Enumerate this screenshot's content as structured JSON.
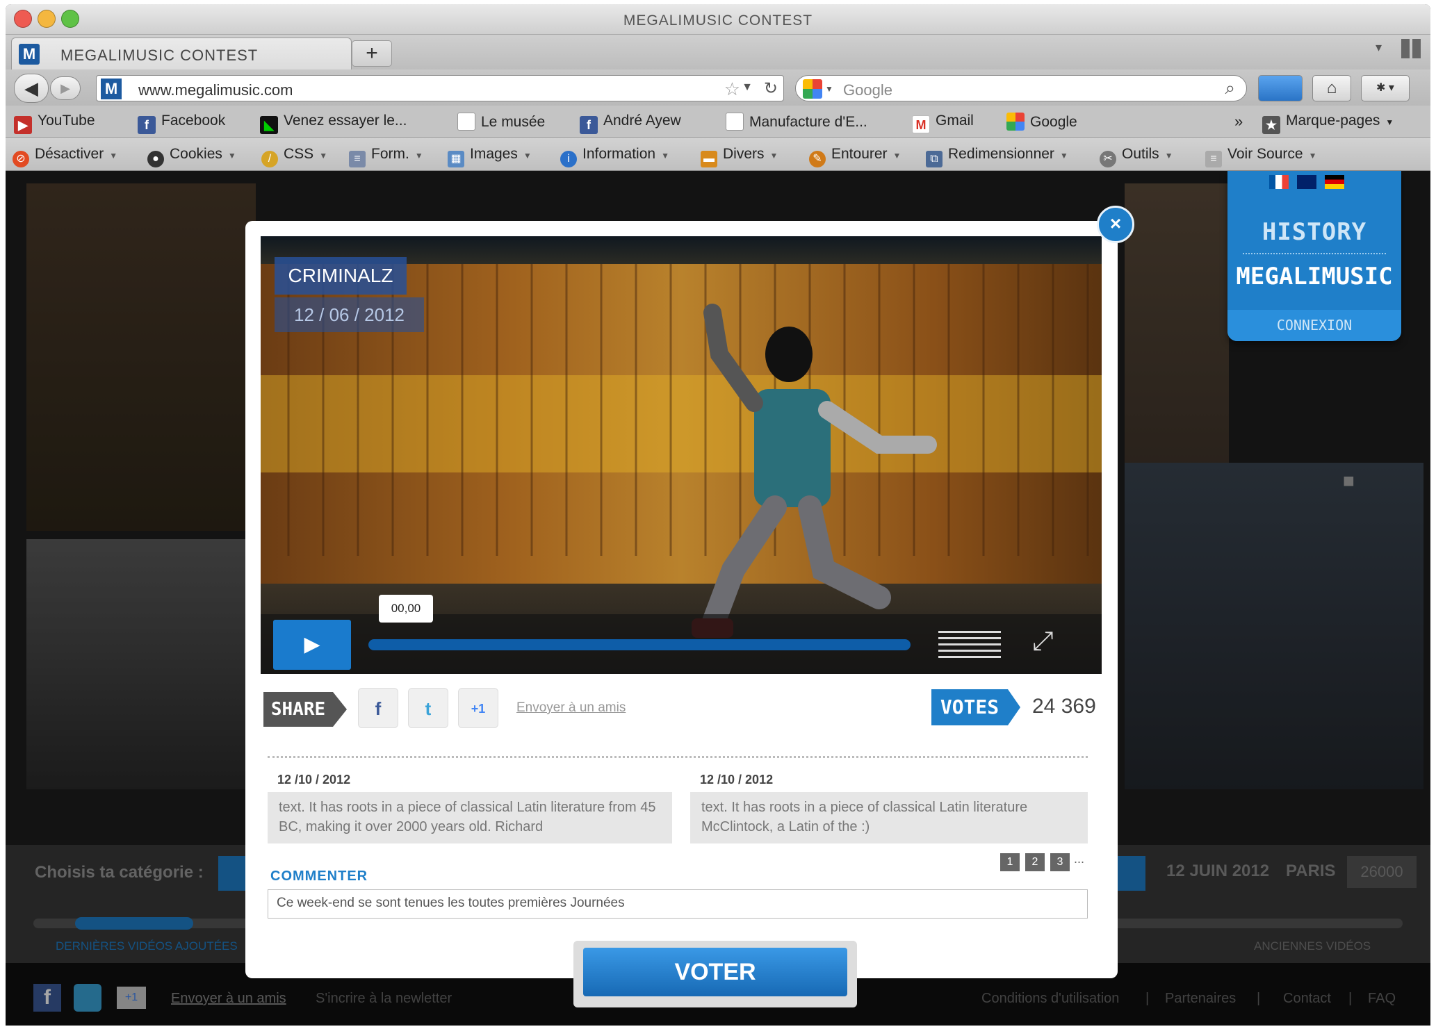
{
  "window": {
    "title": "MEGALIMUSIC CONTEST"
  },
  "tab": {
    "label": "MEGALIMUSIC CONTEST",
    "new_tab": "+"
  },
  "navbar": {
    "url": "www.megalimusic.com",
    "search_placeholder": "Google"
  },
  "bookmarks": {
    "items": [
      "YouTube",
      "Facebook",
      "Venez essayer le...",
      "Le musée",
      "André Ayew",
      "Manufacture d'E...",
      "Gmail",
      "Google"
    ],
    "more": "»",
    "folder": "Marque-pages"
  },
  "devbar": {
    "items": [
      "Désactiver",
      "Cookies",
      "CSS",
      "Form.",
      "Images",
      "Information",
      "Divers",
      "Entourer",
      "Redimensionner",
      "Outils",
      "Voir Source"
    ]
  },
  "history_panel": {
    "title": "HISTORY",
    "brand": "MEGALIMUSIC",
    "login": "CONNEXION"
  },
  "background": {
    "category_label": "Choisis ta catégorie :",
    "event_date": "12 JUIN 2012",
    "event_city": "PARIS",
    "event_code": "26000",
    "latest_videos": "DERNIÈRES VIDÉOS AJOUTÉES",
    "older_videos": "ANCIENNES VIDÉOS",
    "footer_left": [
      "Envoyer à un amis",
      "S'incrire à la newletter"
    ],
    "footer_right": [
      "Conditions d'utilisation",
      "Partenaires",
      "Contact",
      "FAQ"
    ],
    "footer_separator": "|"
  },
  "modal": {
    "close": "×",
    "video": {
      "title": "CRIMINALZ",
      "date": "12 / 06 / 2012",
      "timecode": "00,00",
      "progress_pct": 0
    },
    "share": {
      "label": "SHARE",
      "send_link": "Envoyer à un amis"
    },
    "votes": {
      "label": "VOTES",
      "count": "24 369"
    },
    "comments": [
      {
        "date": "12 /10 / 2012",
        "text": "text. It has roots in a piece of classical Latin literature from 45 BC, making it over 2000 years old. Richard"
      },
      {
        "date": "12 /10 / 2012",
        "text": "text. It has roots in a piece of classical Latin literature McClintock, a Latin of the  :)"
      }
    ],
    "pagination": [
      "1",
      "2",
      "3",
      "..."
    ],
    "commenter_label": "COMMENTER",
    "comment_input_value": "Ce week-end se sont tenues les toutes premières Journées",
    "vote_button": "VOTER"
  },
  "colors": {
    "accent": "#1f7fc9"
  }
}
